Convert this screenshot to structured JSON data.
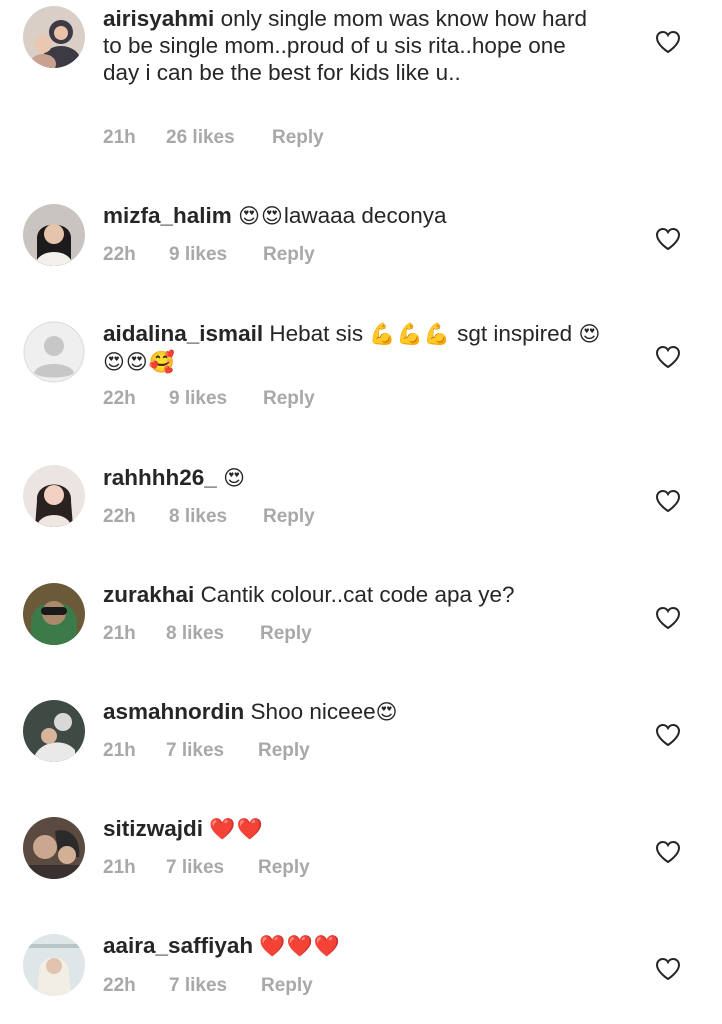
{
  "comments": [
    {
      "username": "airisyahmi",
      "text": "only single mom was know how hard to be single mom..proud of u sis rita..hope one day i can be the best for kids like u..",
      "emoji": "",
      "time": "21h",
      "likes": "26 likes",
      "reply": "Reply"
    },
    {
      "username": "mizfa_halim",
      "text": "",
      "emoji": "😍😍",
      "text_after": "lawaaa deconya",
      "time": "22h",
      "likes": "9 likes",
      "reply": "Reply"
    },
    {
      "username": "aidalina_ismail",
      "text": "Hebat sis",
      "emoji": "💪💪💪",
      "text_after": "sgt inspired",
      "emoji2": "😍😍😍🥰",
      "time": "22h",
      "likes": "9 likes",
      "reply": "Reply"
    },
    {
      "username": "rahhhh26_",
      "text": "",
      "emoji": "😍",
      "time": "22h",
      "likes": "8 likes",
      "reply": "Reply"
    },
    {
      "username": "zurakhai",
      "text": "Cantik colour..cat code apa ye?",
      "emoji": "",
      "time": "21h",
      "likes": "8 likes",
      "reply": "Reply"
    },
    {
      "username": "asmahnordin",
      "text": "Shoo niceee",
      "emoji": "😍",
      "time": "21h",
      "likes": "7 likes",
      "reply": "Reply"
    },
    {
      "username": "sitizwajdi",
      "text": "",
      "emoji": "❤️❤️",
      "time": "21h",
      "likes": "7 likes",
      "reply": "Reply"
    },
    {
      "username": "aaira_saffiyah",
      "text": "",
      "emoji": "❤️❤️❤️",
      "time": "22h",
      "likes": "7 likes",
      "reply": "Reply"
    }
  ],
  "icons": {
    "like": "heart-outline-icon",
    "avatar_default": "default-avatar-icon"
  },
  "colors": {
    "text": "#262626",
    "meta": "#a8a8a8",
    "heart_stroke": "#262626",
    "background": "#ffffff"
  }
}
